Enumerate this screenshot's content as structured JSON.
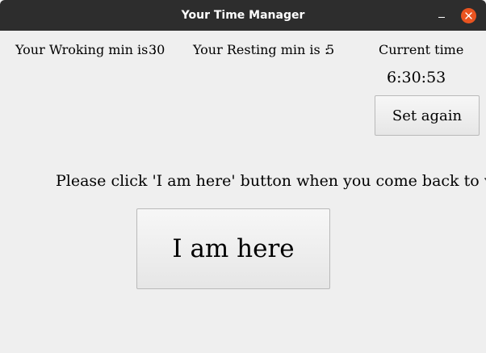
{
  "window": {
    "title": "Your Time Manager"
  },
  "working": {
    "label": "Your Wroking min is :",
    "value": "30"
  },
  "resting": {
    "label": "Your Resting min is :",
    "value": "5"
  },
  "clock": {
    "label": "Current time",
    "value": "6:30:53"
  },
  "buttons": {
    "set_again": "Set again",
    "i_am_here": "I am here"
  },
  "message": "Please click 'I am here' button when you come back to work!",
  "colors": {
    "titlebar": "#2d2d2d",
    "close": "#e95420",
    "background": "#efefef"
  }
}
